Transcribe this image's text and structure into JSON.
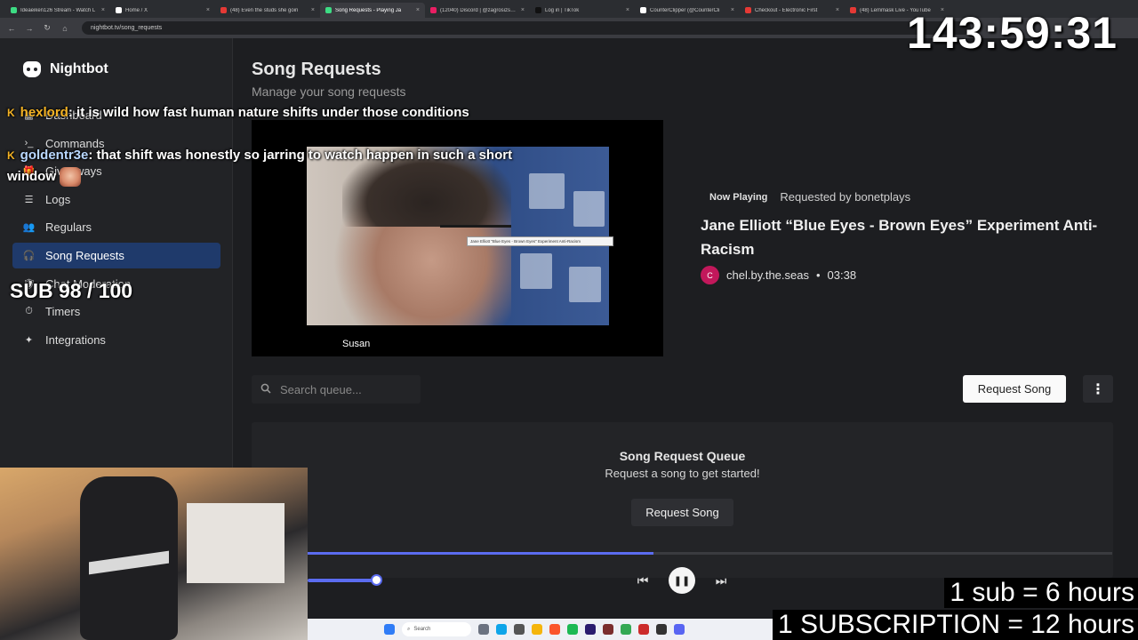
{
  "browser": {
    "tabs": [
      {
        "label": "Ideaeiken126 Stream - Watch L",
        "color": "#3ddc84"
      },
      {
        "label": "Home / X",
        "color": "#ffffff"
      },
      {
        "label": "(48) Even the studs she goin",
        "color": "#e53935"
      },
      {
        "label": "Song Requests - Playing Ja",
        "color": "#3ddc84",
        "active": true
      },
      {
        "label": "(12040) Discord | @zagrosizsolan",
        "color": "#e91e63"
      },
      {
        "label": "Log in | TikTok",
        "color": "#111111"
      },
      {
        "label": "CounterClipper (@CounterCli",
        "color": "#ffffff"
      },
      {
        "label": "Checkout - Electronic First",
        "color": "#e53935"
      },
      {
        "label": "(48) Lemmask Live - YouTube",
        "color": "#e53935"
      }
    ],
    "url": "nightbot.tv/song_requests"
  },
  "sidebar": {
    "brand": "Nightbot",
    "items": [
      {
        "label": "Dashboard",
        "icon": "dashboard-icon"
      },
      {
        "label": "Commands",
        "icon": "terminal-icon"
      },
      {
        "label": "Giveaways",
        "icon": "gift-icon"
      },
      {
        "label": "Logs",
        "icon": "list-icon"
      },
      {
        "label": "Regulars",
        "icon": "users-icon"
      },
      {
        "label": "Song Requests",
        "icon": "headphones-icon",
        "active": true
      },
      {
        "label": "Chat Moderation",
        "icon": "shield-icon"
      },
      {
        "label": "Timers",
        "icon": "clock-icon"
      },
      {
        "label": "Integrations",
        "icon": "puzzle-icon"
      }
    ]
  },
  "main": {
    "title": "Song Requests",
    "subtitle": "Manage your song requests",
    "video_tooltip": "Jane Elliott \"Blue Eyes - Brown Eyes\" Experiment Anti-Racism",
    "video_caption": "Susan",
    "now_playing": {
      "badge": "Now Playing",
      "requested_by": "Requested by bonetplays",
      "song_title": "Jane Elliott “Blue Eyes - Brown Eyes” Experiment Anti-Racism",
      "avatar_letter": "C",
      "channel": "chel.by.the.seas",
      "separator": "•",
      "duration": "03:38"
    },
    "search_placeholder": "Search queue...",
    "request_button": "Request Song",
    "queue": {
      "title": "Song Request Queue",
      "subtitle": "Request a song to get started!",
      "button": "Request Song"
    },
    "progress_fraction": 0.43,
    "volume_fraction": 1.0
  },
  "overlay": {
    "timer": "143:59:31",
    "chat": [
      {
        "user": "hexlord",
        "message": ": it is wild how fast human nature shifts under those conditions"
      },
      {
        "user": "goldentr3e",
        "message": ": that shift was honestly so jarring to watch happen in such a short window"
      }
    ],
    "sub_goal": "SUB 98 / 100",
    "promo_1": "1 sub = 6 hours",
    "promo_2": "1 SUBSCRIPTION = 12 hours",
    "taskbar_search": "Search"
  }
}
